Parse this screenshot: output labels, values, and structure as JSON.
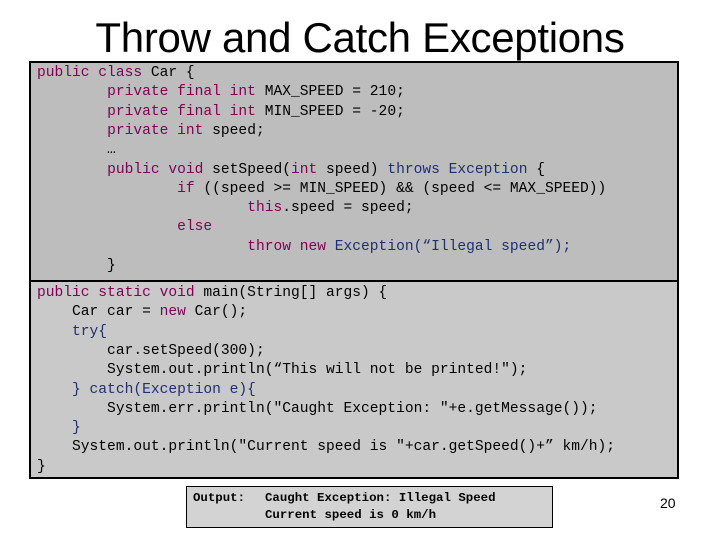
{
  "slide": {
    "title": "Throw and Catch Exceptions",
    "page_number": "20"
  },
  "colors": {
    "keyword": "#7f0055",
    "type_blue": "#1f2f6f",
    "box1_bg": "#bdbdbd",
    "box2_bg": "#c9c9c9",
    "output_bg": "#d3d3d3"
  },
  "class_code": [
    [
      {
        "t": "public class",
        "c": "kw"
      },
      {
        "t": " Car {",
        "c": ""
      }
    ],
    [
      {
        "t": "        ",
        "c": ""
      },
      {
        "t": "private final int",
        "c": "kw"
      },
      {
        "t": " MAX_SPEED = 210;",
        "c": ""
      }
    ],
    [
      {
        "t": "        ",
        "c": ""
      },
      {
        "t": "private final int",
        "c": "kw"
      },
      {
        "t": " MIN_SPEED = -20;",
        "c": ""
      }
    ],
    [
      {
        "t": "        ",
        "c": ""
      },
      {
        "t": "private int",
        "c": "kw"
      },
      {
        "t": " speed;",
        "c": ""
      }
    ],
    [
      {
        "t": "        …",
        "c": ""
      }
    ],
    [
      {
        "t": "        ",
        "c": ""
      },
      {
        "t": "public void",
        "c": "kw"
      },
      {
        "t": " setSpeed(",
        "c": ""
      },
      {
        "t": "int",
        "c": "kw"
      },
      {
        "t": " speed) ",
        "c": ""
      },
      {
        "t": "throws Exception",
        "c": "bl"
      },
      {
        "t": " {",
        "c": ""
      }
    ],
    [
      {
        "t": "                ",
        "c": ""
      },
      {
        "t": "if",
        "c": "kw"
      },
      {
        "t": " ((speed >= MIN_SPEED) && (speed <= MAX_SPEED))",
        "c": ""
      }
    ],
    [
      {
        "t": "                        ",
        "c": ""
      },
      {
        "t": "this",
        "c": "kw"
      },
      {
        "t": ".speed = speed;",
        "c": ""
      }
    ],
    [
      {
        "t": "                ",
        "c": ""
      },
      {
        "t": "else",
        "c": "kw"
      }
    ],
    [
      {
        "t": "                        ",
        "c": ""
      },
      {
        "t": "throw new",
        "c": "kw"
      },
      {
        "t": " Exception(“Illegal speed”);",
        "c": "bl"
      }
    ],
    [
      {
        "t": "        }",
        "c": ""
      }
    ]
  ],
  "main_code": [
    [
      {
        "t": "public static void",
        "c": "kw"
      },
      {
        "t": " main(String[] args) {",
        "c": ""
      }
    ],
    [
      {
        "t": "    Car car = ",
        "c": ""
      },
      {
        "t": "new",
        "c": "kw"
      },
      {
        "t": " Car();",
        "c": ""
      }
    ],
    [
      {
        "t": "    ",
        "c": ""
      },
      {
        "t": "try{",
        "c": "bl"
      }
    ],
    [
      {
        "t": "        car.setSpeed(300);",
        "c": ""
      }
    ],
    [
      {
        "t": "        System.out.println(“This will not be printed!\");",
        "c": ""
      }
    ],
    [
      {
        "t": "    ",
        "c": ""
      },
      {
        "t": "} catch(Exception e){",
        "c": "bl"
      }
    ],
    [
      {
        "t": "        System.err.println(\"Caught Exception: \"+e.getMessage());",
        "c": ""
      }
    ],
    [
      {
        "t": "    ",
        "c": ""
      },
      {
        "t": "}",
        "c": "bl"
      }
    ],
    [
      {
        "t": "    System.out.println(\"Current speed is \"+car.getSpeed()+” km/h);",
        "c": ""
      }
    ],
    [
      {
        "t": "}",
        "c": ""
      }
    ]
  ],
  "output": {
    "label": "Output:",
    "lines": [
      "Caught Exception: Illegal Speed",
      "Current speed is 0 km/h"
    ]
  }
}
